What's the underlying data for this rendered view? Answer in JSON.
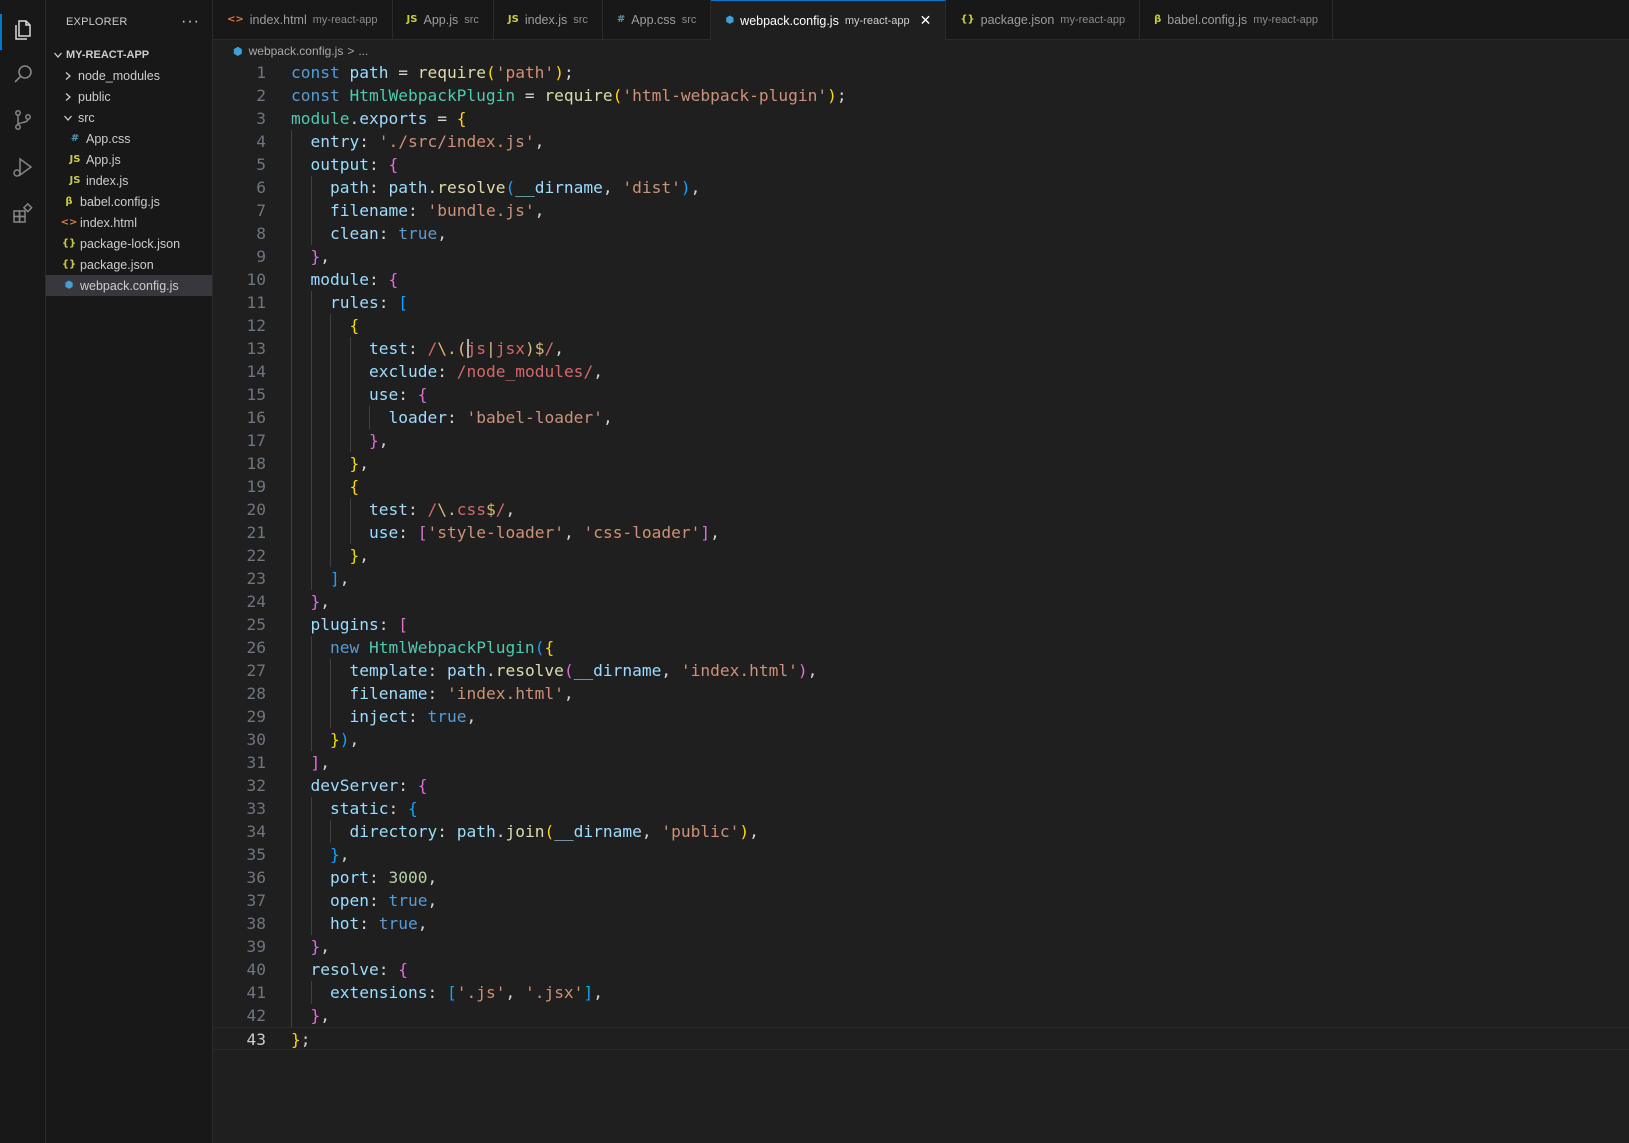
{
  "explorer": {
    "title": "EXPLORER",
    "more": "···",
    "project": "MY-REACT-APP",
    "items": [
      {
        "label": "node_modules",
        "kind": "folder-closed",
        "depth": 1
      },
      {
        "label": "public",
        "kind": "folder-closed",
        "depth": 1
      },
      {
        "label": "src",
        "kind": "folder-open",
        "depth": 1
      },
      {
        "label": "App.css",
        "kind": "css",
        "depth": 2
      },
      {
        "label": "App.js",
        "kind": "js",
        "depth": 2
      },
      {
        "label": "index.js",
        "kind": "js",
        "depth": 2
      },
      {
        "label": "babel.config.js",
        "kind": "babel",
        "depth": 1
      },
      {
        "label": "index.html",
        "kind": "html",
        "depth": 1
      },
      {
        "label": "package-lock.json",
        "kind": "json",
        "depth": 1
      },
      {
        "label": "package.json",
        "kind": "json",
        "depth": 1
      },
      {
        "label": "webpack.config.js",
        "kind": "webpack",
        "depth": 1,
        "selected": true
      }
    ]
  },
  "tabs": [
    {
      "label": "index.html",
      "desc": "my-react-app",
      "icon": "<>",
      "kind": "html"
    },
    {
      "label": "App.js",
      "desc": "src",
      "icon": "JS",
      "kind": "js"
    },
    {
      "label": "index.js",
      "desc": "src",
      "icon": "JS",
      "kind": "js"
    },
    {
      "label": "App.css",
      "desc": "src",
      "icon": "#",
      "kind": "css"
    },
    {
      "label": "webpack.config.js",
      "desc": "my-react-app",
      "icon": "⬢",
      "kind": "webpack",
      "active": true
    },
    {
      "label": "package.json",
      "desc": "my-react-app",
      "icon": "{}",
      "kind": "json"
    },
    {
      "label": "babel.config.js",
      "desc": "my-react-app",
      "icon": "β",
      "kind": "babel"
    }
  ],
  "breadcrumb": {
    "file": "webpack.config.js",
    "sep": ">",
    "more": "..."
  },
  "colors": {
    "js": "#cbcb41",
    "css": "#519aba",
    "html": "#e37933",
    "json": "#cbcb41",
    "babel": "#cbcb41",
    "webpack": "#3ea0d5",
    "accent": "#0078d4"
  },
  "editor": {
    "current_line": 43,
    "lines": [
      "const path = require('path');",
      "const HtmlWebpackPlugin = require('html-webpack-plugin');",
      "module.exports = {",
      "  entry: './src/index.js',",
      "  output: {",
      "    path: path.resolve(__dirname, 'dist'),",
      "    filename: 'bundle.js',",
      "    clean: true,",
      "  },",
      "  module: {",
      "    rules: [",
      "      {",
      "        test: /\\.(js|jsx)$/,",
      "        exclude: /node_modules/,",
      "        use: {",
      "          loader: 'babel-loader',",
      "        },",
      "      },",
      "      {",
      "        test: /\\.css$/,",
      "        use: ['style-loader', 'css-loader'],",
      "      },",
      "    ],",
      "  },",
      "  plugins: [",
      "    new HtmlWebpackPlugin({",
      "      template: path.resolve(__dirname, 'index.html'),",
      "      filename: 'index.html',",
      "      inject: true,",
      "    }),",
      "  ],",
      "  devServer: {",
      "    static: {",
      "      directory: path.join(__dirname, 'public'),",
      "    },",
      "    port: 3000,",
      "    open: true,",
      "    hot: true,",
      "  },",
      "  resolve: {",
      "    extensions: ['.js', '.jsx'],",
      "  },",
      "};"
    ]
  }
}
